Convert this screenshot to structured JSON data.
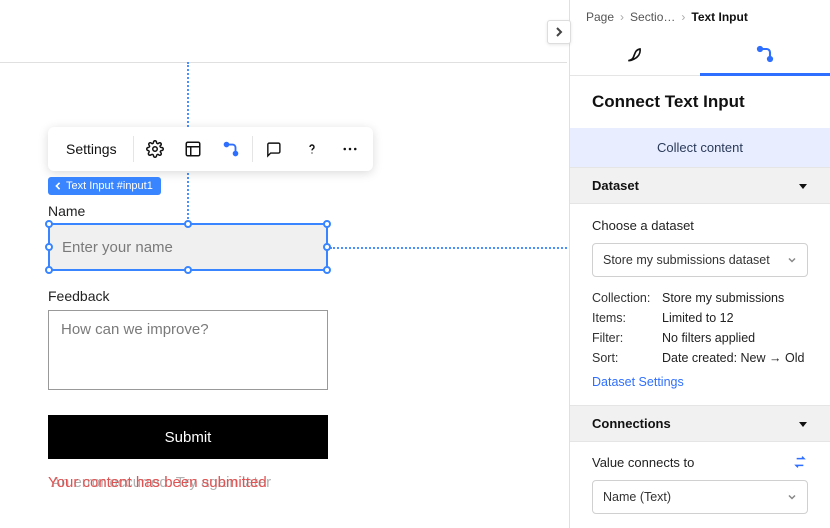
{
  "toolbar": {
    "settings_label": "Settings"
  },
  "element_badge": "Text Input #input1",
  "form": {
    "name_label": "Name",
    "name_placeholder": "Enter your name",
    "feedback_label": "Feedback",
    "feedback_placeholder": "How can we improve?",
    "submit_label": "Submit",
    "success_msg": "Your content has been submitted",
    "error_msg": "An error occurred. Try again later"
  },
  "breadcrumb": {
    "page": "Page",
    "section": "Sectio…",
    "current": "Text Input"
  },
  "panel": {
    "title": "Connect Text Input",
    "collect": "Collect content",
    "dataset": {
      "header": "Dataset",
      "choose_label": "Choose a dataset",
      "selected": "Store my submissions dataset",
      "collection_k": "Collection:",
      "collection_v": "Store my submissions",
      "items_k": "Items:",
      "items_v": "Limited to 12",
      "filter_k": "Filter:",
      "filter_v": "No filters applied",
      "sort_k": "Sort:",
      "sort_v": "Date created: New → Old",
      "settings_link": "Dataset Settings"
    },
    "connections": {
      "header": "Connections",
      "value_label": "Value connects to",
      "value_selected": "Name (Text)"
    }
  }
}
